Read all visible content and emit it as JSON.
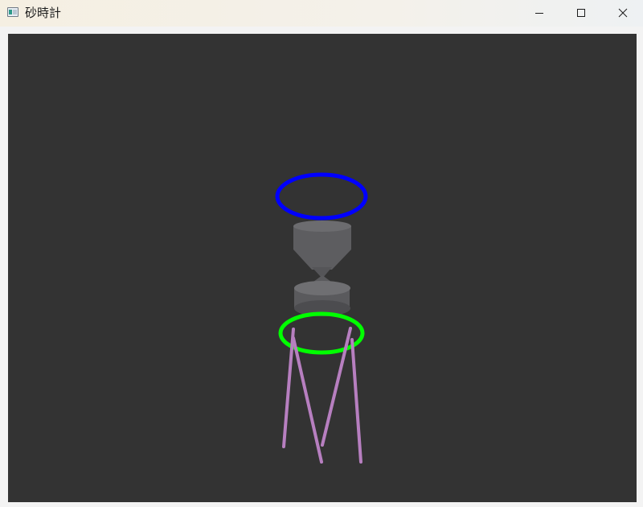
{
  "window": {
    "title": "砂時計",
    "icon": "app-window-icon",
    "controls": {
      "minimize_icon": "minimize-icon",
      "maximize_icon": "maximize-icon",
      "close_icon": "close-icon"
    }
  },
  "viewport": {
    "background_color": "#333333",
    "objects": {
      "top_ring_color": "#0000ff",
      "bottom_ring_color": "#00ff00",
      "hourglass_color": "#5f5f61",
      "legs_color": "#b77fc0"
    }
  }
}
